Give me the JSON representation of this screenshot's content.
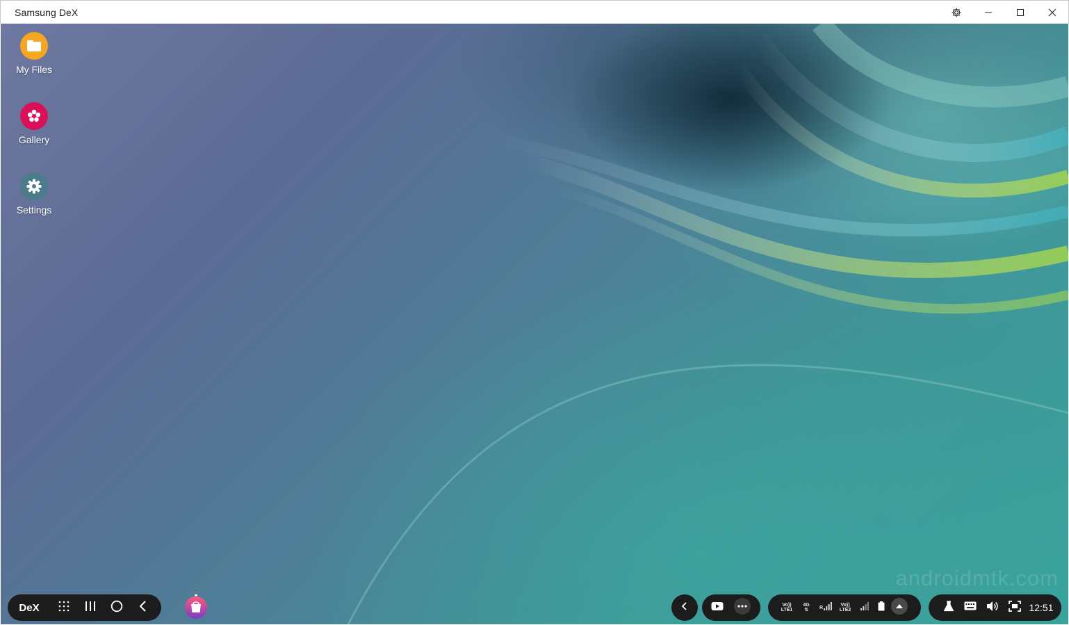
{
  "window": {
    "title": "Samsung DeX",
    "controls": [
      "settings-icon",
      "minimize-icon",
      "maximize-icon",
      "close-icon"
    ]
  },
  "desktop": {
    "icons": [
      {
        "label": "My Files",
        "icon": "folder-icon",
        "color": "#f5a623"
      },
      {
        "label": "Gallery",
        "icon": "flower-icon",
        "color": "#d8105a"
      },
      {
        "label": "Settings",
        "icon": "gear-icon",
        "color": "#4a7c8a"
      }
    ],
    "watermark": "androidmtk.com"
  },
  "taskbar": {
    "dex_label": "DeX",
    "nav": [
      "apps-grid-icon",
      "recent-apps-icon",
      "home-icon",
      "back-icon"
    ],
    "pinned": [
      {
        "name": "galaxy-store-icon"
      }
    ],
    "tray_left": [
      "chevron-left-icon",
      "youtube-icon",
      "more-icon"
    ],
    "status": {
      "volte1": "Vo))",
      "lte1": "LTE1",
      "net": "4G",
      "roaming": "R",
      "volte2": "Vo))",
      "lte2": "LTE2"
    },
    "right": [
      "lab-icon",
      "keyboard-icon",
      "volume-icon",
      "screenshot-icon"
    ],
    "time": "12:51"
  },
  "colors": {
    "taskbar_bg": "#1c1c1c",
    "titlebar_bg": "#ffffff"
  }
}
